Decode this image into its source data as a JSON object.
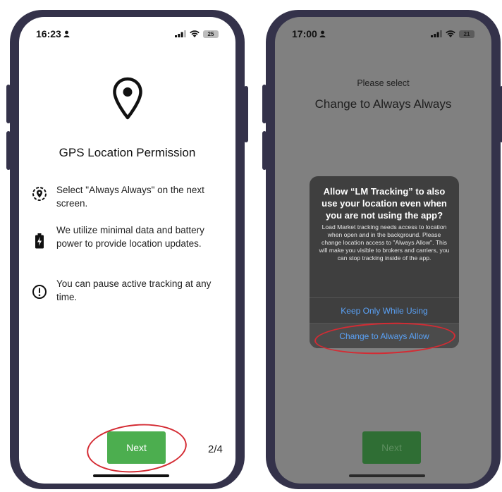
{
  "left_phone": {
    "status": {
      "time": "16:23",
      "battery": "25"
    },
    "title": "GPS Location Permission",
    "items": [
      {
        "icon": "location-target-icon",
        "text": "Select \"Always Always\" on the next screen."
      },
      {
        "icon": "battery-charging-icon",
        "text": "We utilize minimal data and battery power to provide location updates."
      },
      {
        "icon": "alert-circle-icon",
        "text": "You can pause active tracking at any time."
      }
    ],
    "next_label": "Next",
    "page_indicator": "2/4"
  },
  "right_phone": {
    "status": {
      "time": "17:00",
      "battery": "21"
    },
    "subtitle": "Please select",
    "title": "Change to Always Always",
    "dialog": {
      "title": "Allow “LM Tracking” to also use your location even when you are not using the app?",
      "message": "Load Market tracking needs access to location when open and in the background. Please change location access to \"Always Allow\". This will make you visible to brokers and carriers, you can stop tracking inside of the app.",
      "buttons": [
        "Keep Only While Using",
        "Change to Always Allow"
      ]
    },
    "next_label": "Next"
  },
  "colors": {
    "accent_green": "#4cae4f",
    "dimmed_green": "#2f6e34",
    "phone_frame": "#34324a",
    "ios_blue": "#5aa1f5",
    "highlight_red": "#d42b33",
    "dim_overlay": "#808080"
  }
}
